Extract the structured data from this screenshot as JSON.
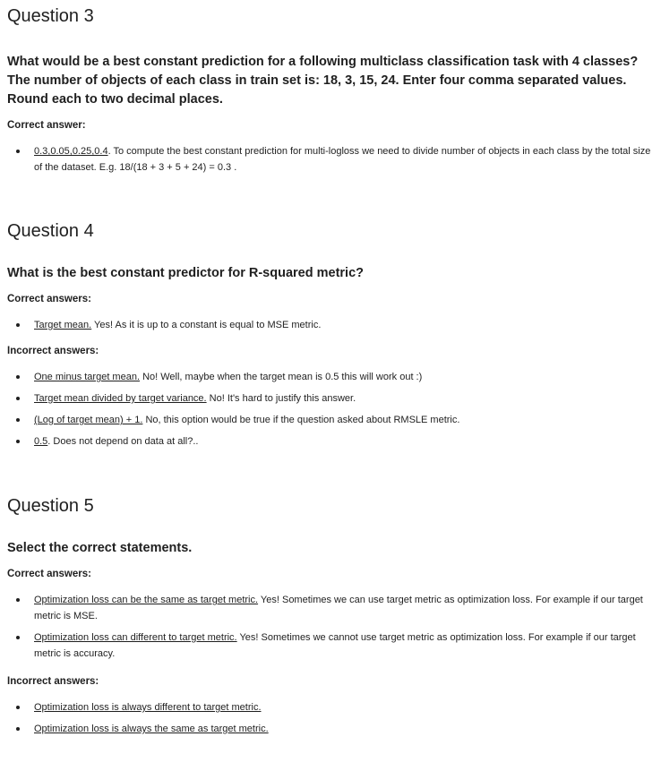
{
  "q3": {
    "title": "Question 3",
    "text": "What would be a best constant prediction for a following multiclass classification task with 4 classes? The number of objects of each class in train set is: 18, 3, 15, 24. Enter four comma separated values. Round each to two decimal places.",
    "correct_label": "Correct answer:",
    "correct": [
      {
        "answer": "0.3,0.05,0.25,0.4",
        "explanation": ". To compute the best constant prediction for multi-logloss we need to divide number of objects in each class by the total size of the dataset. E.g. 18/(18 + 3 + 5 + 24)  = 0.3 ."
      }
    ]
  },
  "q4": {
    "title": "Question 4",
    "text": "What is the best constant predictor for R-squared metric?",
    "correct_label": "Correct answers:",
    "correct": [
      {
        "answer": "Target mean.",
        "explanation": " Yes! As it is up to a constant is equal to MSE metric."
      }
    ],
    "incorrect_label": "Incorrect answers:",
    "incorrect": [
      {
        "answer": "One minus target mean.",
        "explanation": " No! Well, maybe when the target mean is 0.5 this will work out :)"
      },
      {
        "answer": "Target mean divided by target variance.",
        "explanation": " No! It's hard to justify this answer."
      },
      {
        "answer": "(Log of target mean) + 1.",
        "explanation": " No, this option would be true if the question asked about RMSLE metric."
      },
      {
        "answer": "0.5",
        "explanation": ". Does not depend on data at all?.."
      }
    ]
  },
  "q5": {
    "title": "Question 5",
    "text": "Select the correct statements.",
    "correct_label": "Correct answers:",
    "correct": [
      {
        "answer": "Optimization loss can be the same as target metric.",
        "explanation": " Yes! Sometimes we can use target metric as optimization loss. For example if our target metric is MSE."
      },
      {
        "answer": "Optimization loss can different to target metric.",
        "explanation": " Yes! Sometimes we cannot use target metric as optimization loss. For example if our target metric is accuracy."
      }
    ],
    "incorrect_label": "Incorrect answers:",
    "incorrect": [
      {
        "answer": "Optimization loss is always different to target metric.",
        "explanation": ""
      },
      {
        "answer": "Optimization loss is always the same as target metric.",
        "explanation": ""
      }
    ]
  }
}
